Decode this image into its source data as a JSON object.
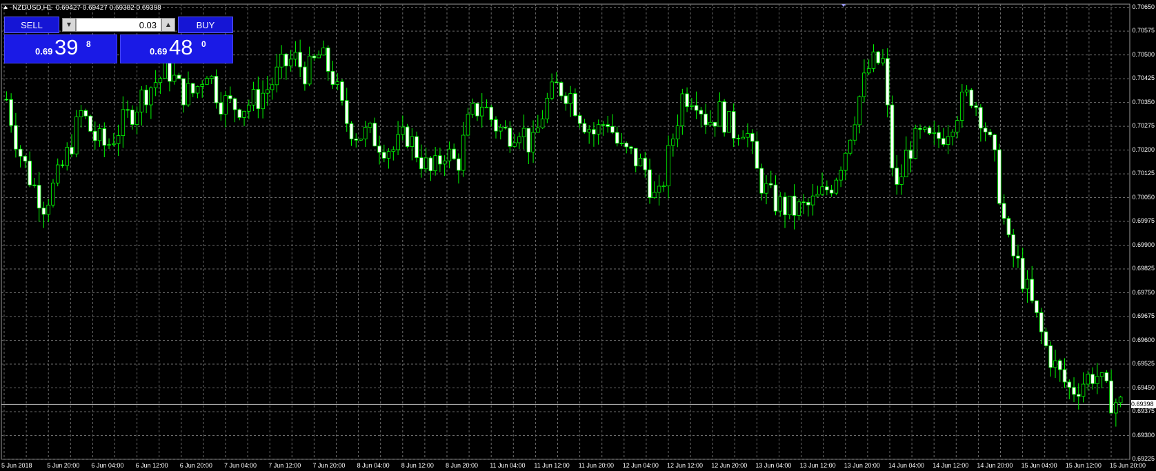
{
  "header": {
    "symbol": "NZDUSD,H1",
    "ohlc": "0.69427 0.69427 0.69382 0.69398"
  },
  "one_click_trading": {
    "sell_label": "SELL",
    "buy_label": "BUY",
    "lot_size": "0.03",
    "sell_price": {
      "prefix": "0.69",
      "big": "39",
      "sup": "8"
    },
    "buy_price": {
      "prefix": "0.69",
      "big": "48",
      "sup": "0"
    }
  },
  "price_scale": [
    "0.70650",
    "0.70575",
    "0.70500",
    "0.70425",
    "0.70350",
    "0.70275",
    "0.70200",
    "0.70125",
    "0.70050",
    "0.69975",
    "0.69900",
    "0.69825",
    "0.69750",
    "0.69675",
    "0.69600",
    "0.69525",
    "0.69450",
    "0.69398",
    "0.69375",
    "0.69300",
    "0.69225"
  ],
  "time_scale": [
    "5 Jun 2018",
    "5 Jun 20:00",
    "6 Jun 04:00",
    "6 Jun 12:00",
    "6 Jun 20:00",
    "7 Jun 04:00",
    "7 Jun 12:00",
    "7 Jun 20:00",
    "8 Jun 04:00",
    "8 Jun 12:00",
    "8 Jun 20:00",
    "11 Jun 04:00",
    "11 Jun 12:00",
    "11 Jun 20:00",
    "12 Jun 04:00",
    "12 Jun 12:00",
    "12 Jun 20:00",
    "13 Jun 04:00",
    "13 Jun 12:00",
    "13 Jun 20:00",
    "14 Jun 04:00",
    "14 Jun 12:00",
    "14 Jun 20:00",
    "15 Jun 04:00",
    "15 Jun 12:00",
    "15 Jun 20:00"
  ],
  "current_price_tag": "0.69398",
  "colors": {
    "background": "#000000",
    "grid": "#6b6b6b",
    "candle": "#00ff00",
    "bull_body": "#000000",
    "bear_body": "#ffffff",
    "panel": "#1a1ae6"
  },
  "chart_data": {
    "type": "candlestick",
    "symbol": "NZDUSD",
    "timeframe": "H1",
    "ylim": [
      0.69225,
      0.7066
    ],
    "close_path": [
      0.7036,
      0.702,
      0.701,
      0.7003,
      0.701,
      0.702,
      0.7032,
      0.7024,
      0.7021,
      0.7027,
      0.7032,
      0.7038,
      0.7042,
      0.7045,
      0.7038,
      0.7038,
      0.7046,
      0.7036,
      0.7034,
      0.7034,
      0.7036,
      0.704,
      0.7046,
      0.7049,
      0.7044,
      0.705,
      0.7044,
      0.703,
      0.7025,
      0.7025,
      0.7022,
      0.702,
      0.7025,
      0.7018,
      0.7012,
      0.702,
      0.7015,
      0.703,
      0.7035,
      0.7028,
      0.7025,
      0.7028,
      0.702,
      0.7034,
      0.704,
      0.7038,
      0.703,
      0.7025,
      0.703,
      0.702,
      0.7018,
      0.7014,
      0.7002,
      0.702,
      0.7037,
      0.7038,
      0.7029,
      0.7032,
      0.7026,
      0.7028,
      0.7012,
      0.7005,
      0.7002,
      0.7001,
      0.7002,
      0.7005,
      0.701,
      0.702,
      0.7035,
      0.7047,
      0.7048,
      0.7005,
      0.702,
      0.7024,
      0.7022,
      0.7026,
      0.7033,
      0.7038,
      0.703,
      0.7015,
      0.699,
      0.6982,
      0.697,
      0.6958,
      0.695,
      0.6944,
      0.6947,
      0.695,
      0.6942,
      0.69398
    ]
  }
}
